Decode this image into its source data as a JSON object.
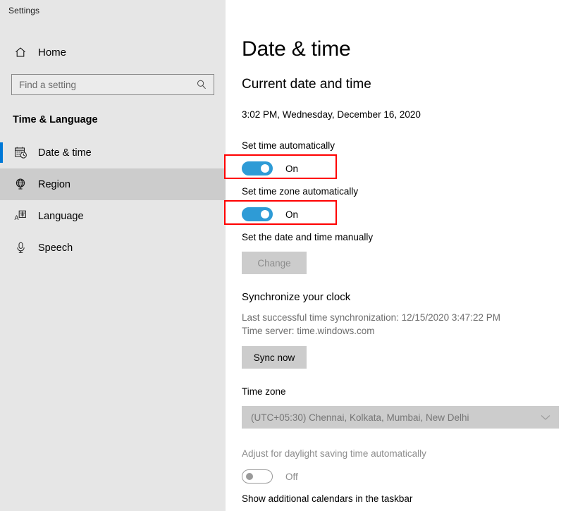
{
  "window": {
    "title": "Settings"
  },
  "sidebar": {
    "home": {
      "label": "Home",
      "icon": "home-icon"
    },
    "search": {
      "placeholder": "Find a setting",
      "value": "",
      "icon": "search-icon"
    },
    "section_header": "Time & Language",
    "items": [
      {
        "label": "Date & time",
        "icon": "calendar-clock-icon",
        "selected": true,
        "hovered": false
      },
      {
        "label": "Region",
        "icon": "globe-icon",
        "selected": false,
        "hovered": true
      },
      {
        "label": "Language",
        "icon": "language-icon",
        "selected": false,
        "hovered": false
      },
      {
        "label": "Speech",
        "icon": "microphone-icon",
        "selected": false,
        "hovered": false
      }
    ]
  },
  "main": {
    "page_title": "Date & time",
    "current_section_title": "Current date and time",
    "current_datetime": "3:02 PM, Wednesday, December 16, 2020",
    "set_time_automatically": {
      "label": "Set time automatically",
      "state": "On",
      "enabled": true,
      "highlighted": true
    },
    "set_timezone_automatically": {
      "label": "Set time zone automatically",
      "state": "On",
      "enabled": true,
      "highlighted": true
    },
    "set_manually": {
      "label": "Set the date and time manually",
      "button_label": "Change",
      "button_enabled": false
    },
    "synchronize": {
      "title": "Synchronize your clock",
      "last_sync": "Last successful time synchronization: 12/15/2020 3:47:22 PM",
      "time_server": "Time server: time.windows.com",
      "button_label": "Sync now",
      "button_enabled": true
    },
    "time_zone": {
      "label": "Time zone",
      "selected": "(UTC+05:30) Chennai, Kolkata, Mumbai, New Delhi",
      "enabled": false,
      "chevron_icon": "chevron-down-icon"
    },
    "daylight_saving": {
      "label": "Adjust for daylight saving time automatically",
      "state": "Off",
      "enabled": false
    },
    "additional_calendars": {
      "label": "Show additional calendars in the taskbar"
    }
  },
  "colors": {
    "accent": "#0078d7",
    "toggle_on": "#2e9bd6",
    "annotation": "#ff0000",
    "sidebar_bg": "#e6e6e6",
    "hover_bg": "#cccccc"
  }
}
